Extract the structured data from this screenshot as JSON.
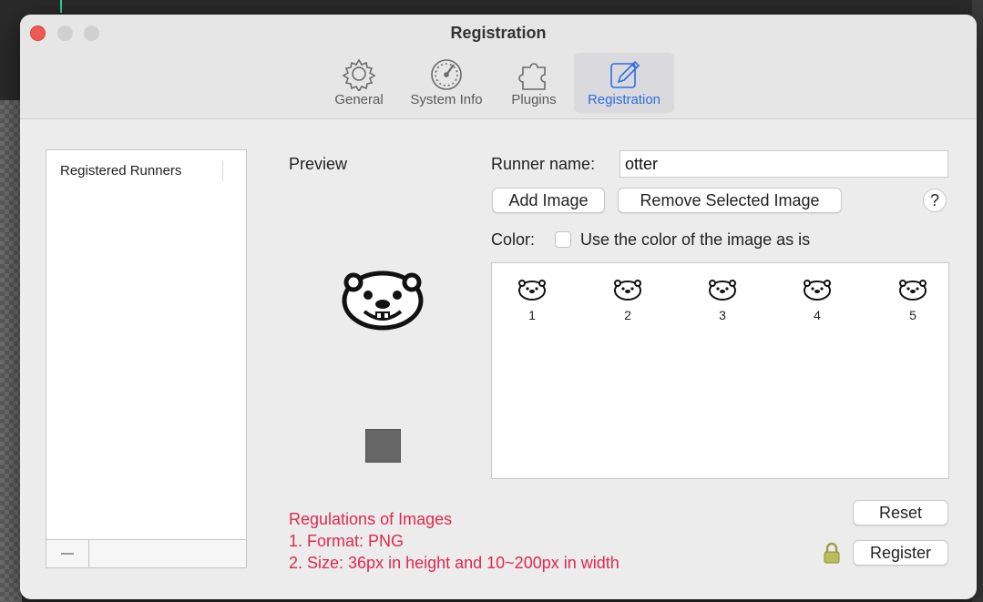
{
  "window": {
    "title": "Registration"
  },
  "tabs": [
    {
      "label": "General",
      "icon": "gear-icon"
    },
    {
      "label": "System Info",
      "icon": "gauge-icon"
    },
    {
      "label": "Plugins",
      "icon": "puzzle-icon"
    },
    {
      "label": "Registration",
      "icon": "pen-icon",
      "active": true
    }
  ],
  "list": {
    "header": "Registered Runners",
    "items": []
  },
  "preview": {
    "label": "Preview",
    "icon": "otter-icon",
    "swatch_color": "#666666"
  },
  "form": {
    "runner_label": "Runner name:",
    "runner_value": "otter",
    "add_image": "Add Image",
    "remove_image": "Remove Selected Image",
    "help": "?",
    "color_label": "Color:",
    "use_color_label": "Use the color of the image as is",
    "use_color_checked": false
  },
  "frames": [
    {
      "number": "1"
    },
    {
      "number": "2"
    },
    {
      "number": "3"
    },
    {
      "number": "4"
    },
    {
      "number": "5"
    }
  ],
  "regulations": {
    "title": "Regulations of Images",
    "line1": "1. Format: PNG",
    "line2": "2. Size: 36px in height and 10~200px in width"
  },
  "buttons": {
    "reset": "Reset",
    "register": "Register"
  },
  "colors": {
    "accent": "#2d6fe0",
    "regulation_text": "#e0284f",
    "close": "#ee5a52"
  }
}
